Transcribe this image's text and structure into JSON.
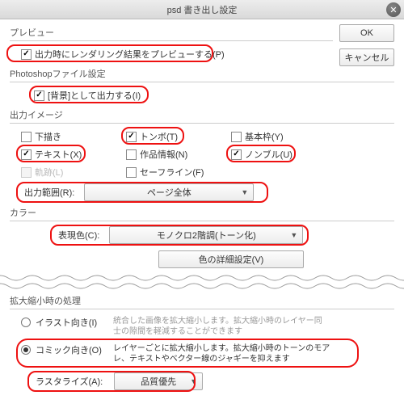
{
  "title": "psd 書き出し設定",
  "buttons": {
    "ok": "OK",
    "cancel": "キャンセル"
  },
  "preview": {
    "title": "プレビュー",
    "cb_preview": "出力時にレンダリング結果をプレビューする(P)"
  },
  "psfile": {
    "title": "Photoshopファイル設定",
    "cb_background": "[背景]として出力する(I)"
  },
  "image": {
    "title": "出力イメージ",
    "cb_draft": "下描き",
    "cb_tonbo": "トンボ(T)",
    "cb_basicframe": "基本枠(Y)",
    "cb_text": "テキスト(X)",
    "cb_workinfo": "作品情報(N)",
    "cb_nombre": "ノンブル(U)",
    "cb_track": "軌跡(L)",
    "cb_safeline": "セーフライン(F)",
    "range_label": "出力範囲(R):",
    "range_value": "ページ全体"
  },
  "color": {
    "title": "カラー",
    "expr_label": "表現色(C):",
    "expr_value": "モノクロ2階調(トーン化)",
    "detail_btn": "色の詳細設定(V)"
  },
  "zoom": {
    "title": "拡大縮小時の処理",
    "radio_illust": "イラスト向き(I)",
    "illust_desc": "統合した画像を拡大縮小します。拡大縮小時のレイヤー同士の隙間を軽減することができます",
    "radio_comic": "コミック向き(O)",
    "comic_desc": "レイヤーごとに拡大縮小します。拡大縮小時のトーンのモアレ、テキストやベクター線のジャギーを抑えます",
    "raster_label": "ラスタライズ(A):",
    "raster_value": "品質優先"
  }
}
